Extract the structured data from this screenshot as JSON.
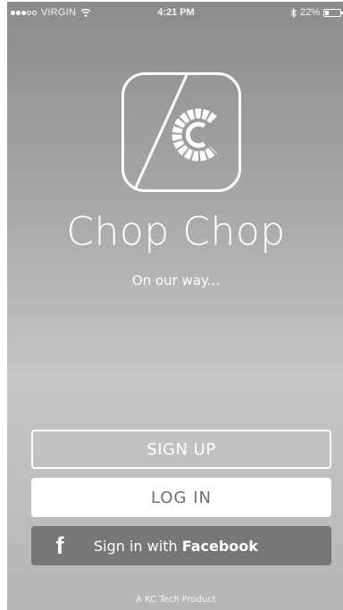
{
  "status_bar": {
    "carrier": "VIRGIN",
    "signal_bars_on": 3,
    "signal_bars_total": 5,
    "time": "4:21 PM",
    "battery_text": "22%",
    "battery_level": 0.22,
    "icons": [
      "signal-dots",
      "wifi-icon",
      "bluetooth-icon",
      "battery-icon"
    ]
  },
  "logo": {
    "icon": "chop-chop-logo-icon"
  },
  "app": {
    "title": "Chop Chop",
    "tagline": "On our way..."
  },
  "buttons": {
    "signup_label": "SIGN UP",
    "login_label": "LOG IN",
    "facebook_icon_text": "f",
    "facebook_label_prefix": "Sign in with",
    "facebook_label_brand": "Facebook"
  },
  "footer": {
    "text": "A KC Tech Product"
  },
  "colors": {
    "background_top": "#8c8c8c",
    "background_bottom": "#b6b6b6",
    "button_text_dark": "#6e6e6e",
    "facebook_button": "#777777"
  }
}
